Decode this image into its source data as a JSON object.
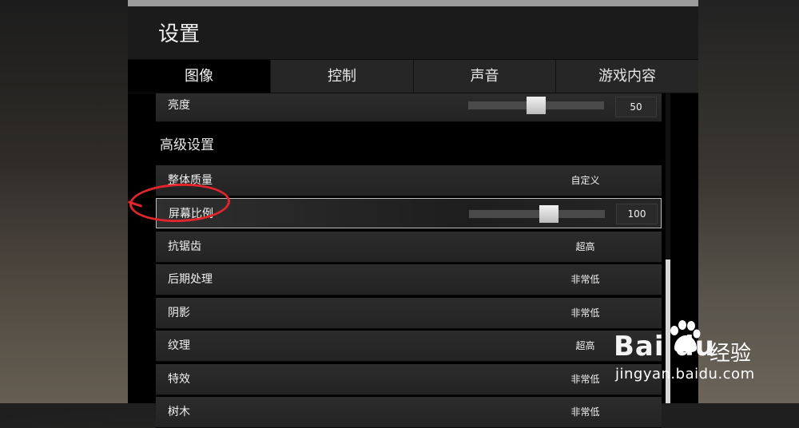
{
  "window": {
    "title": "设置"
  },
  "tabs": [
    {
      "label": "图像",
      "active": true
    },
    {
      "label": "控制",
      "active": false
    },
    {
      "label": "声音",
      "active": false
    },
    {
      "label": "游戏内容",
      "active": false
    }
  ],
  "brightness": {
    "label": "亮度",
    "value": "50",
    "level_percent": 50
  },
  "section": {
    "title": "高级设置"
  },
  "rows": {
    "overall_quality": {
      "label": "整体质量",
      "value": "自定义"
    },
    "screen_scale": {
      "label": "屏幕比例",
      "value": "100",
      "level_percent": 60
    },
    "antialiasing": {
      "label": "抗锯齿",
      "value": "超高"
    },
    "post_processing": {
      "label": "后期处理",
      "value": "非常低"
    },
    "shadows": {
      "label": "阴影",
      "value": "非常低"
    },
    "textures": {
      "label": "纹理",
      "value": "超高"
    },
    "effects": {
      "label": "特效",
      "value": "非常低"
    },
    "foliage": {
      "label": "树木",
      "value": "非常低"
    }
  },
  "annotation": {
    "color": "#e0262c"
  },
  "watermark": {
    "brand": "Bai du",
    "suffix": "经验",
    "url": "jingyan.baidu.com"
  }
}
